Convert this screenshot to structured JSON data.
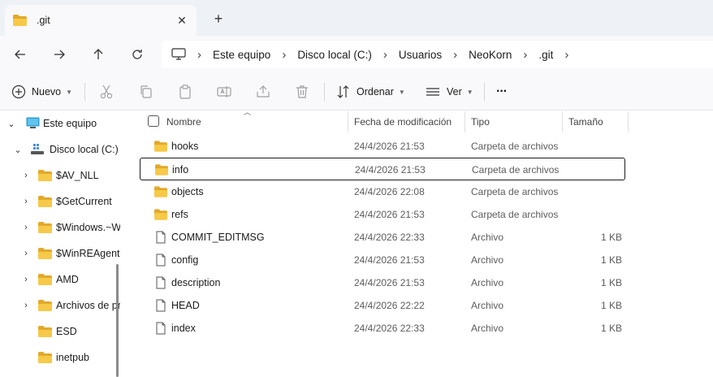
{
  "tab": {
    "title": ".git",
    "close_glyph": "✕",
    "new_tab_glyph": "+"
  },
  "address": {
    "crumbs": [
      "Este equipo",
      "Disco local (C:)",
      "Usuarios",
      "NeoKorn",
      ".git"
    ],
    "separator": "›"
  },
  "commands": {
    "new_label": "Nuevo",
    "sort_label": "Ordenar",
    "view_label": "Ver",
    "more_label": "···"
  },
  "sidebar": {
    "items": [
      {
        "label": "Este equipo",
        "icon": "computer-icon",
        "expanded": true
      },
      {
        "label": "Disco local (C:)",
        "icon": "drive-icon",
        "expanded": true
      },
      {
        "label": "$AV_NLL",
        "icon": "folder-icon"
      },
      {
        "label": "$GetCurrent",
        "icon": "folder-icon"
      },
      {
        "label": "$Windows.~WS",
        "icon": "folder-icon"
      },
      {
        "label": "$WinREAgent",
        "icon": "folder-icon"
      },
      {
        "label": "AMD",
        "icon": "folder-icon"
      },
      {
        "label": "Archivos de programa",
        "icon": "folder-icon"
      },
      {
        "label": "ESD",
        "icon": "folder-icon"
      },
      {
        "label": "inetpub",
        "icon": "folder-icon"
      }
    ]
  },
  "columns": {
    "name": "Nombre",
    "date": "Fecha de modificación",
    "type": "Tipo",
    "size": "Tamaño"
  },
  "files": [
    {
      "name": "hooks",
      "date": "24/4/2026 21:53",
      "type": "Carpeta de archivos",
      "size": "",
      "kind": "folder"
    },
    {
      "name": "info",
      "date": "24/4/2026 21:53",
      "type": "Carpeta de archivos",
      "size": "",
      "kind": "folder",
      "selected": true
    },
    {
      "name": "objects",
      "date": "24/4/2026 22:08",
      "type": "Carpeta de archivos",
      "size": "",
      "kind": "folder"
    },
    {
      "name": "refs",
      "date": "24/4/2026 21:53",
      "type": "Carpeta de archivos",
      "size": "",
      "kind": "folder"
    },
    {
      "name": "COMMIT_EDITMSG",
      "date": "24/4/2026 22:33",
      "type": "Archivo",
      "size": "1 KB",
      "kind": "file"
    },
    {
      "name": "config",
      "date": "24/4/2026 21:53",
      "type": "Archivo",
      "size": "1 KB",
      "kind": "file"
    },
    {
      "name": "description",
      "date": "24/4/2026 21:53",
      "type": "Archivo",
      "size": "1 KB",
      "kind": "file"
    },
    {
      "name": "HEAD",
      "date": "24/4/2026 22:22",
      "type": "Archivo",
      "size": "1 KB",
      "kind": "file"
    },
    {
      "name": "index",
      "date": "24/4/2026 22:33",
      "type": "Archivo",
      "size": "1 KB",
      "kind": "file"
    }
  ],
  "colors": {
    "folder": "#f7c948",
    "folder_dark": "#e2a92a",
    "accent": "#0067c0"
  }
}
